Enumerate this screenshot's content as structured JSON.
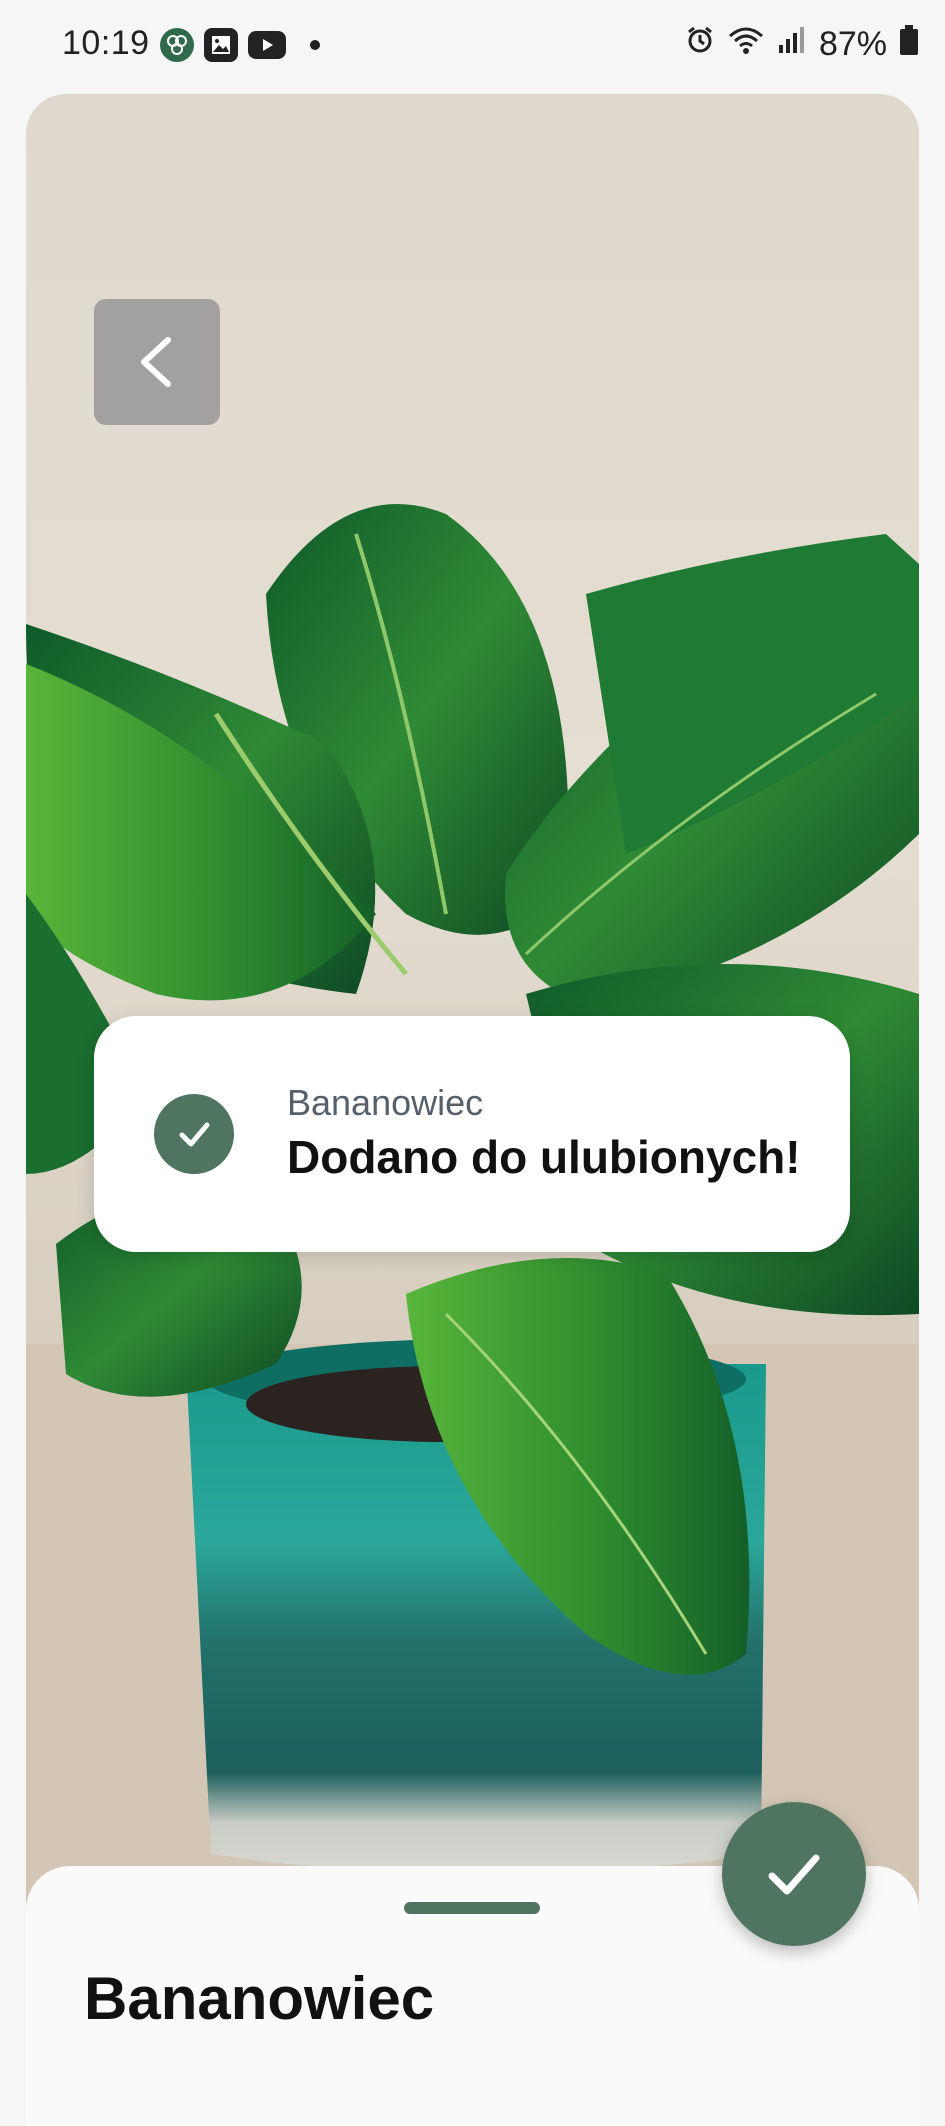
{
  "status_bar": {
    "time": "10:19",
    "battery": "87%",
    "notification_icons": [
      "plant-app-icon",
      "gallery-icon",
      "youtube-icon"
    ],
    "system_icons": [
      "alarm-icon",
      "wifi-icon",
      "signal-icon",
      "battery-icon"
    ]
  },
  "header": {
    "back_icon": "chevron-left-icon"
  },
  "toast": {
    "subtitle": "Bananowiec",
    "title": "Dodano do ulubionych!",
    "icon": "check-icon"
  },
  "sheet": {
    "title": "Bananowiec"
  },
  "fab": {
    "icon": "check-icon"
  },
  "colors": {
    "accent": "#4f7560",
    "background": "#f6f6f6",
    "toast_bg": "#ffffff"
  }
}
